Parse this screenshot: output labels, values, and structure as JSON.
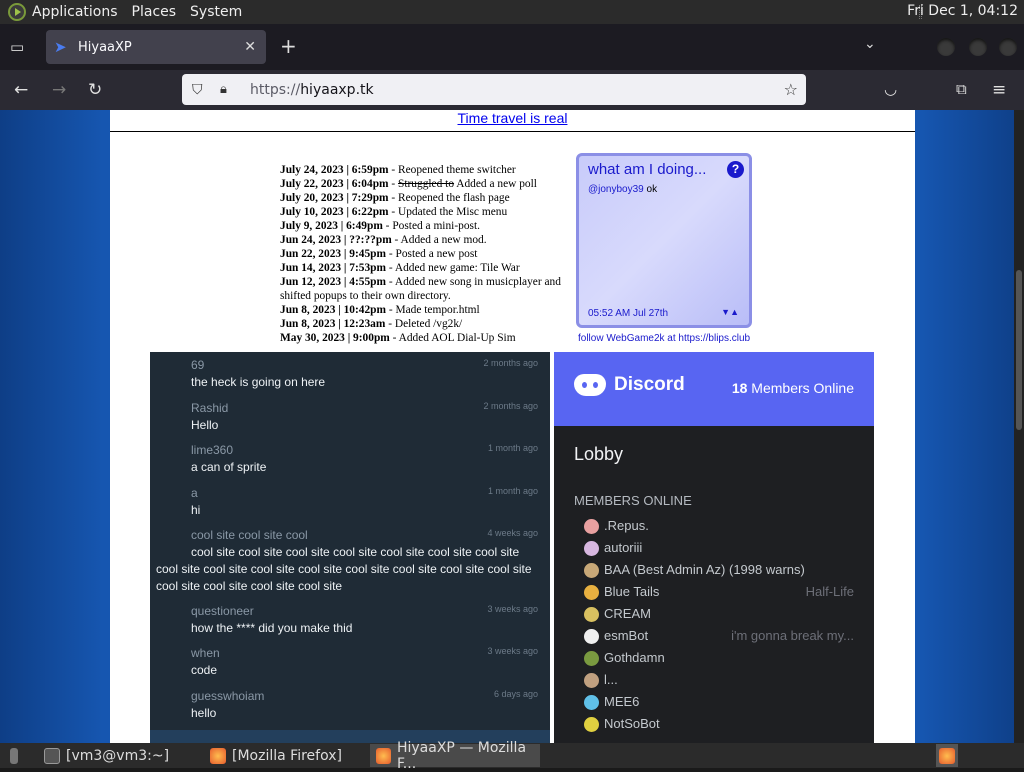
{
  "panel": {
    "menus": [
      "Applications",
      "Places",
      "System"
    ],
    "clock": "Fri Dec 1, 04:12"
  },
  "browser": {
    "tab_title": "HiyaaXP",
    "url_proto": "https://",
    "url_host": "hiyaaxp.tk"
  },
  "page": {
    "top_link": "Time travel is real",
    "updates": [
      {
        "date": "July 24, 2023 | 6:59pm",
        "text": " - Reopened theme switcher",
        "strike": ""
      },
      {
        "date": "July 22, 2023 | 6:04pm",
        "text": " Added a new poll",
        "strike": "Struggled to"
      },
      {
        "date": "July 20, 2023 | 7:29pm",
        "text": " - Reopened the flash page",
        "strike": ""
      },
      {
        "date": "July 10, 2023 | 6:22pm",
        "text": " - Updated the Misc menu",
        "strike": ""
      },
      {
        "date": "July 9, 2023 | 6:49pm",
        "text": " - Posted a mini-post.",
        "strike": ""
      },
      {
        "date": "Jun 24, 2023 | ??:??pm",
        "text": " - Added a new mod.",
        "strike": ""
      },
      {
        "date": "Jun 22, 2023 | 9:45pm",
        "text": " - Posted a new post",
        "strike": ""
      },
      {
        "date": "Jun 14, 2023 | 7:53pm",
        "text": " - Added new game: Tile War",
        "strike": ""
      },
      {
        "date": "Jun 12, 2023 | 4:55pm",
        "text": " - Added new song in musicplayer and shifted popups to their own directory.",
        "strike": ""
      },
      {
        "date": "Jun 8, 2023 | 10:42pm",
        "text": " - Made tempor.html",
        "strike": ""
      },
      {
        "date": "Jun 8, 2023 | 12:23am",
        "text": " - Deleted /vg2k/",
        "strike": ""
      },
      {
        "date": "May 30, 2023 | 9:00pm",
        "text": " - Added AOL Dial-Up Sim",
        "strike": ""
      }
    ],
    "blips": {
      "title": "what am I doing...",
      "help": "?",
      "user": "@jonyboy39",
      "post": " ok",
      "time": "05:52 AM Jul 27th",
      "arrows": "▼▲",
      "follow": "follow WebGame2k at https://blips.club"
    },
    "chat": [
      {
        "name": "69",
        "time": "2 months ago",
        "text": "the heck is going on here"
      },
      {
        "name": "Rashid",
        "time": "2 months ago",
        "text": "Hello"
      },
      {
        "name": "lime360",
        "time": "1 month ago",
        "text": "a can of sprite"
      },
      {
        "name": "a",
        "time": "1 month ago",
        "text": "hi"
      },
      {
        "name": "cool site cool site cool",
        "time": "4 weeks ago",
        "text": "cool site cool site cool site cool site cool site cool site cool site cool site cool site cool site cool site cool site cool site cool site cool site cool site cool site cool site cool site"
      },
      {
        "name": "questioneer",
        "time": "3 weeks ago",
        "text": "how the **** did you make thid"
      },
      {
        "name": "when",
        "time": "3 weeks ago",
        "text": "code"
      },
      {
        "name": "guesswhoiam",
        "time": "6 days ago",
        "text": "hello"
      }
    ],
    "discord": {
      "brand": "Discord",
      "online_count": "18",
      "online_label": " Members Online",
      "channel": "Lobby",
      "members_heading": "MEMBERS ONLINE",
      "members": [
        {
          "name": ".Repus.",
          "activity": "",
          "color": "#e8a0a0"
        },
        {
          "name": "autoriii",
          "activity": "",
          "color": "#d7b7e0"
        },
        {
          "name": "BAA (Best Admin Az) (1998 warns)",
          "activity": "",
          "color": "#c8a878"
        },
        {
          "name": "Blue Tails",
          "activity": "Half-Life",
          "color": "#e8b040"
        },
        {
          "name": "CREAM",
          "activity": "",
          "color": "#d8c060"
        },
        {
          "name": "esmBot",
          "activity": "i'm gonna break my...",
          "color": "#f0f0f0"
        },
        {
          "name": "Gothdamn",
          "activity": "",
          "color": "#7a9a40"
        },
        {
          "name": "l...",
          "activity": "",
          "color": "#c0a080"
        },
        {
          "name": "MEE6",
          "activity": "",
          "color": "#60c0e8"
        },
        {
          "name": "NotSoBot",
          "activity": "",
          "color": "#e0d040"
        }
      ]
    }
  },
  "taskbar": {
    "items": [
      "[vm3@vm3:~]",
      "[Mozilla Firefox]",
      "HiyaaXP — Mozilla F..."
    ]
  }
}
